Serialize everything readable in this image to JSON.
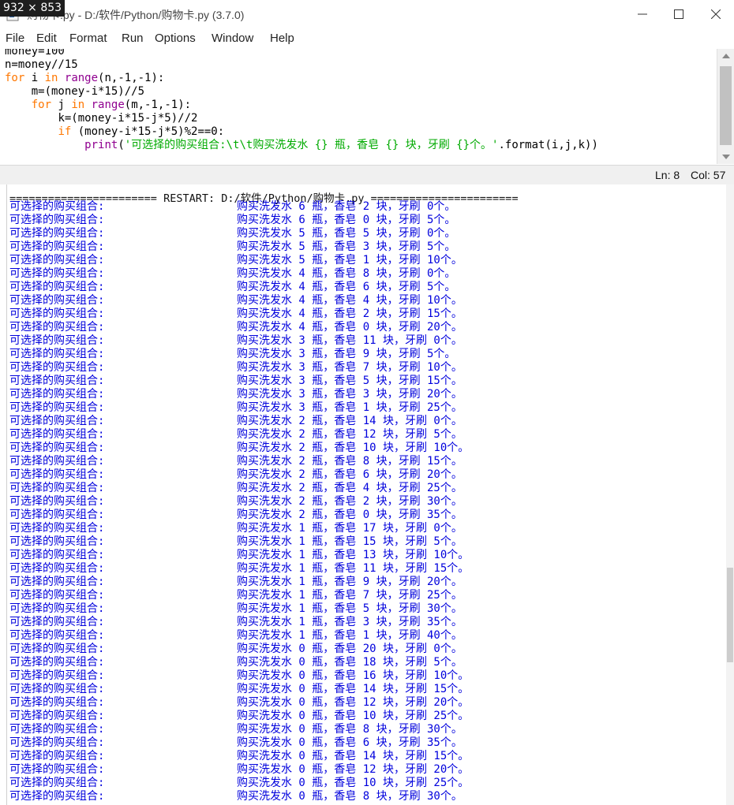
{
  "window": {
    "size_badge": "932 × 853",
    "title": "购物卡.py - D:/软件/Python/购物卡.py (3.7.0)",
    "minimize_icon": "minimize-icon",
    "maximize_icon": "maximize-icon",
    "close_icon": "close-icon"
  },
  "menu": [
    "File",
    "Edit",
    "Format",
    "Run",
    "Options",
    "Window",
    "Help"
  ],
  "editor": {
    "lines": [
      {
        "indent": "",
        "parts": [
          {
            "t": "money=100",
            "c": ""
          }
        ]
      },
      {
        "indent": "",
        "parts": [
          {
            "t": "n=money//15",
            "c": ""
          }
        ]
      },
      {
        "indent": "",
        "parts": [
          {
            "t": "for",
            "c": "kw"
          },
          {
            "t": " i ",
            "c": ""
          },
          {
            "t": "in",
            "c": "kw"
          },
          {
            "t": " ",
            "c": ""
          },
          {
            "t": "range",
            "c": "bi"
          },
          {
            "t": "(n,-1,-1):",
            "c": ""
          }
        ]
      },
      {
        "indent": "    ",
        "parts": [
          {
            "t": "m=(money-i*15)//5",
            "c": ""
          }
        ]
      },
      {
        "indent": "    ",
        "parts": [
          {
            "t": "for",
            "c": "kw"
          },
          {
            "t": " j ",
            "c": ""
          },
          {
            "t": "in",
            "c": "kw"
          },
          {
            "t": " ",
            "c": ""
          },
          {
            "t": "range",
            "c": "bi"
          },
          {
            "t": "(m,-1,-1):",
            "c": ""
          }
        ]
      },
      {
        "indent": "        ",
        "parts": [
          {
            "t": "k=(money-i*15-j*5)//2",
            "c": ""
          }
        ]
      },
      {
        "indent": "        ",
        "parts": [
          {
            "t": "if",
            "c": "kw"
          },
          {
            "t": " (money-i*15-j*5)%2==0:",
            "c": ""
          }
        ]
      },
      {
        "indent": "            ",
        "parts": [
          {
            "t": "print",
            "c": "bi"
          },
          {
            "t": "(",
            "c": ""
          },
          {
            "t": "'可选择的购买组合:\\t\\t购买洗发水 {} 瓶，香皂 {} 块，牙刷 {}个。'",
            "c": "st"
          },
          {
            "t": ".format(i,j,k))",
            "c": ""
          }
        ]
      }
    ]
  },
  "status": {
    "line": "Ln: 8",
    "col": "Col: 57"
  },
  "shell": {
    "restart_line": "======================= RESTART: D:/软件/Python/购物卡.py =======================",
    "output_label": "可选择的购买组合:",
    "rows": [
      [
        6,
        2,
        0
      ],
      [
        6,
        0,
        5
      ],
      [
        5,
        5,
        0
      ],
      [
        5,
        3,
        5
      ],
      [
        5,
        1,
        10
      ],
      [
        4,
        8,
        0
      ],
      [
        4,
        6,
        5
      ],
      [
        4,
        4,
        10
      ],
      [
        4,
        2,
        15
      ],
      [
        4,
        0,
        20
      ],
      [
        3,
        11,
        0
      ],
      [
        3,
        9,
        5
      ],
      [
        3,
        7,
        10
      ],
      [
        3,
        5,
        15
      ],
      [
        3,
        3,
        20
      ],
      [
        3,
        1,
        25
      ],
      [
        2,
        14,
        0
      ],
      [
        2,
        12,
        5
      ],
      [
        2,
        10,
        10
      ],
      [
        2,
        8,
        15
      ],
      [
        2,
        6,
        20
      ],
      [
        2,
        4,
        25
      ],
      [
        2,
        2,
        30
      ],
      [
        2,
        0,
        35
      ],
      [
        1,
        17,
        0
      ],
      [
        1,
        15,
        5
      ],
      [
        1,
        13,
        10
      ],
      [
        1,
        11,
        15
      ],
      [
        1,
        9,
        20
      ],
      [
        1,
        7,
        25
      ],
      [
        1,
        5,
        30
      ],
      [
        1,
        3,
        35
      ],
      [
        1,
        1,
        40
      ],
      [
        0,
        20,
        0
      ],
      [
        0,
        18,
        5
      ],
      [
        0,
        16,
        10
      ],
      [
        0,
        14,
        15
      ],
      [
        0,
        12,
        20
      ],
      [
        0,
        10,
        25
      ],
      [
        0,
        8,
        30
      ],
      [
        0,
        6,
        35
      ],
      [
        0,
        14,
        15
      ],
      [
        0,
        12,
        20
      ],
      [
        0,
        10,
        25
      ],
      [
        0,
        8,
        30
      ]
    ]
  }
}
